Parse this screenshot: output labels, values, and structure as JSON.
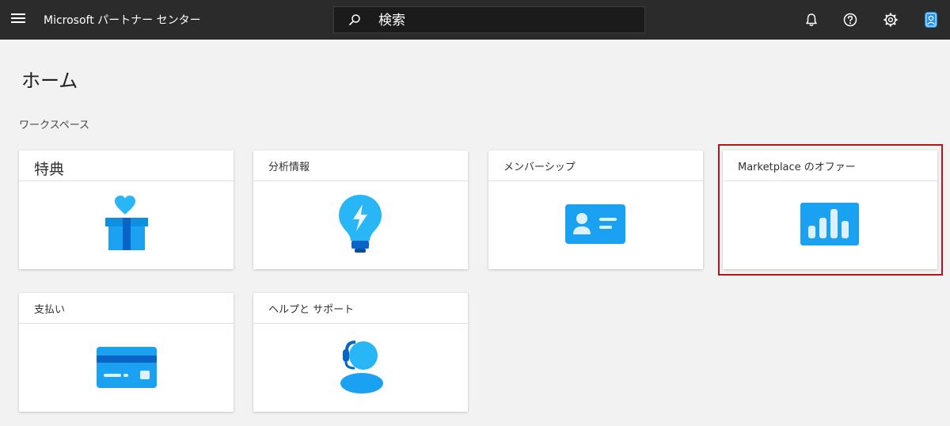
{
  "topbar": {
    "app_title": "Microsoft パートナー センター",
    "search_placeholder": "検索",
    "icons": [
      "menu-icon",
      "bell-icon",
      "help-icon",
      "gear-icon",
      "user-avatar-icon"
    ]
  },
  "page": {
    "title": "ホーム",
    "section_label": "ワークスペース"
  },
  "tiles": [
    {
      "label": "特典",
      "icon": "gift-icon"
    },
    {
      "label": "分析情報",
      "icon": "lightbulb-icon"
    },
    {
      "label": "メンバーシップ",
      "icon": "id-card-icon"
    },
    {
      "label": "Marketplace のオファー",
      "icon": "bar-chart-icon",
      "highlighted": true
    },
    {
      "label": "支払い",
      "icon": "credit-card-icon"
    },
    {
      "label": "ヘルプと サポート",
      "icon": "support-agent-icon"
    }
  ],
  "colors": {
    "topbar": "#2b2b2b",
    "background": "#f2f2f2",
    "highlight_border": "#b4161b",
    "icon_blue": "#0f8fe0",
    "icon_light_blue": "#50d2ff"
  }
}
